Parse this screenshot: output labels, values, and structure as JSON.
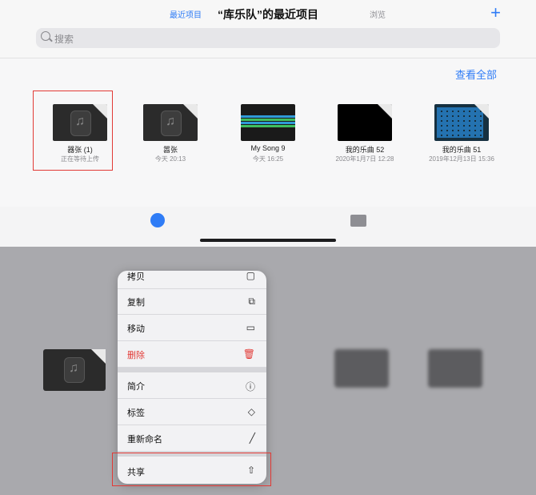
{
  "header": {
    "title": "“库乐队”的最近项目",
    "add_icon": "+"
  },
  "search": {
    "placeholder": "搜索"
  },
  "see_all": "查看全部",
  "files": [
    {
      "name": "器张 (1)",
      "sub": "正在等待上传",
      "thumb": "guitar"
    },
    {
      "name": "嚣张",
      "sub": "今天 20:13",
      "thumb": "guitar"
    },
    {
      "name": "My Song 9",
      "sub": "今天 16:25",
      "thumb": "tracks"
    },
    {
      "name": "我的乐曲 52",
      "sub": "2020年1月7日 12:28",
      "thumb": "black"
    },
    {
      "name": "我的乐曲 51",
      "sub": "2019年12月13日 15:36",
      "thumb": "grid"
    }
  ],
  "tabs": {
    "recent": "最近项目",
    "browse": "浏览"
  },
  "menu": {
    "items": [
      {
        "label": "拷贝",
        "icon": "copy-doc-icon"
      },
      {
        "label": "复制",
        "icon": "duplicate-icon"
      },
      {
        "label": "移动",
        "icon": "folder-icon"
      },
      {
        "label": "删除",
        "icon": "trash-icon"
      },
      {
        "label": "简介",
        "icon": "info-icon"
      },
      {
        "label": "标签",
        "icon": "tag-icon"
      },
      {
        "label": "重新命名",
        "icon": "pencil-icon"
      },
      {
        "label": "共享",
        "icon": "share-icon"
      }
    ]
  },
  "colors": {
    "accent": "#2f7cf6",
    "destructive": "#e23a36",
    "highlight": "#e23a36"
  }
}
